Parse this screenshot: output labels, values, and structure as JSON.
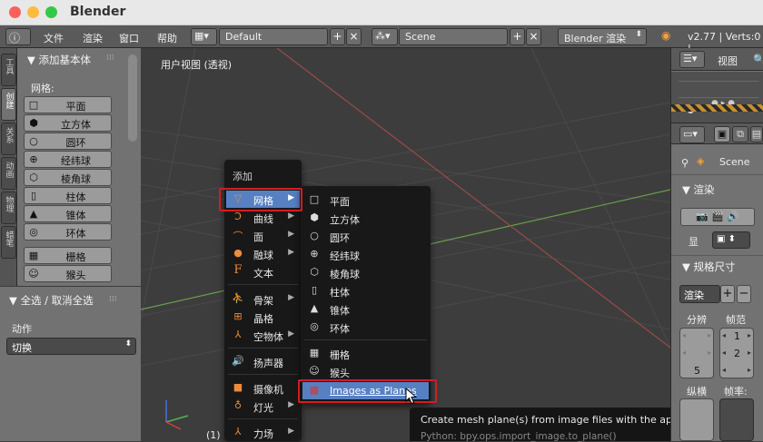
{
  "window": {
    "title": "Blender"
  },
  "infobar": {
    "menus": [
      "文件",
      "渲染",
      "窗口",
      "帮助"
    ],
    "layout": "Default",
    "scene": "Scene",
    "engine": "Blender 渲染",
    "stats": "v2.77 | Verts:0 |"
  },
  "side_tabs": [
    "工具",
    "创建",
    "关系",
    "动画",
    "物理",
    "蜡笔"
  ],
  "toolshelf": {
    "panel_title": "添加基本体",
    "mesh_label": "网格:",
    "buttons": [
      "平面",
      "立方体",
      "圆环",
      "经纬球",
      "棱角球",
      "柱体",
      "锥体",
      "环体",
      "栅格",
      "猴头"
    ]
  },
  "operator": {
    "title": "全选 / 取消全选",
    "action_label": "动作",
    "action_value": "切换"
  },
  "viewport": {
    "label": "用户视图 (透视)",
    "frame": "(1)"
  },
  "add_menu": {
    "title": "添加",
    "items": [
      "网格",
      "曲线",
      "面",
      "融球",
      "文本",
      "骨架",
      "晶格",
      "空物体",
      "扬声器",
      "摄像机",
      "灯光",
      "力场"
    ]
  },
  "mesh_submenu": {
    "items": [
      "平面",
      "立方体",
      "圆环",
      "经纬球",
      "棱角球",
      "柱体",
      "锥体",
      "环体",
      "栅格",
      "猴头",
      "Images as Planes"
    ]
  },
  "tooltip": {
    "text": "Create mesh plane(s) from image files with the appropiate aspect ratio",
    "python": "Python: bpy.ops.import_image.to_plane()"
  },
  "properties": {
    "view_label": "视图",
    "scene_label": "Scene",
    "render_panel": "渲染",
    "render_btn_label": "显",
    "dimensions_panel": "规格尺寸",
    "preset": "渲染",
    "resolution": "分辨",
    "frame_range": "帧范",
    "res_value": "5",
    "frame_vals": [
      "1",
      "2"
    ],
    "aspect": "纵横",
    "fps": "帧率:"
  },
  "colors": {
    "highlight": "#5680c2",
    "annotation": "#d41c24"
  }
}
